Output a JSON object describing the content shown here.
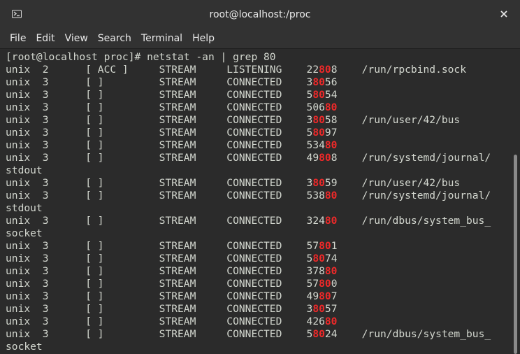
{
  "window": {
    "title": "root@localhost:/proc"
  },
  "menu": [
    "File",
    "Edit",
    "View",
    "Search",
    "Terminal",
    "Help"
  ],
  "terminal": {
    "highlight": "80",
    "highlight_color": "#ef2929",
    "text_color": "#d3d7cf",
    "prompt_line": "[root@localhost proc]# netstat -an | grep 80",
    "rows": [
      {
        "proto": "unix",
        "refcnt": "2",
        "flags": "[ ACC ]",
        "type": "STREAM",
        "state": "LISTENING",
        "inode": "22808",
        "path": "/run/rpcbind.sock"
      },
      {
        "proto": "unix",
        "refcnt": "3",
        "flags": "[ ]",
        "type": "STREAM",
        "state": "CONNECTED",
        "inode": "38056",
        "path": ""
      },
      {
        "proto": "unix",
        "refcnt": "3",
        "flags": "[ ]",
        "type": "STREAM",
        "state": "CONNECTED",
        "inode": "58054",
        "path": ""
      },
      {
        "proto": "unix",
        "refcnt": "3",
        "flags": "[ ]",
        "type": "STREAM",
        "state": "CONNECTED",
        "inode": "50680",
        "path": ""
      },
      {
        "proto": "unix",
        "refcnt": "3",
        "flags": "[ ]",
        "type": "STREAM",
        "state": "CONNECTED",
        "inode": "38058",
        "path": "/run/user/42/bus"
      },
      {
        "proto": "unix",
        "refcnt": "3",
        "flags": "[ ]",
        "type": "STREAM",
        "state": "CONNECTED",
        "inode": "58097",
        "path": ""
      },
      {
        "proto": "unix",
        "refcnt": "3",
        "flags": "[ ]",
        "type": "STREAM",
        "state": "CONNECTED",
        "inode": "53480",
        "path": ""
      },
      {
        "proto": "unix",
        "refcnt": "3",
        "flags": "[ ]",
        "type": "STREAM",
        "state": "CONNECTED",
        "inode": "49808",
        "path": "/run/systemd/journal/",
        "wrap": "stdout"
      },
      {
        "proto": "unix",
        "refcnt": "3",
        "flags": "[ ]",
        "type": "STREAM",
        "state": "CONNECTED",
        "inode": "38059",
        "path": "/run/user/42/bus"
      },
      {
        "proto": "unix",
        "refcnt": "3",
        "flags": "[ ]",
        "type": "STREAM",
        "state": "CONNECTED",
        "inode": "53880",
        "path": "/run/systemd/journal/",
        "wrap": "stdout"
      },
      {
        "proto": "unix",
        "refcnt": "3",
        "flags": "[ ]",
        "type": "STREAM",
        "state": "CONNECTED",
        "inode": "32480",
        "path": "/run/dbus/system_bus_",
        "wrap": "socket"
      },
      {
        "proto": "unix",
        "refcnt": "3",
        "flags": "[ ]",
        "type": "STREAM",
        "state": "CONNECTED",
        "inode": "57801",
        "path": ""
      },
      {
        "proto": "unix",
        "refcnt": "3",
        "flags": "[ ]",
        "type": "STREAM",
        "state": "CONNECTED",
        "inode": "58074",
        "path": ""
      },
      {
        "proto": "unix",
        "refcnt": "3",
        "flags": "[ ]",
        "type": "STREAM",
        "state": "CONNECTED",
        "inode": "37880",
        "path": ""
      },
      {
        "proto": "unix",
        "refcnt": "3",
        "flags": "[ ]",
        "type": "STREAM",
        "state": "CONNECTED",
        "inode": "57800",
        "path": ""
      },
      {
        "proto": "unix",
        "refcnt": "3",
        "flags": "[ ]",
        "type": "STREAM",
        "state": "CONNECTED",
        "inode": "49807",
        "path": ""
      },
      {
        "proto": "unix",
        "refcnt": "3",
        "flags": "[ ]",
        "type": "STREAM",
        "state": "CONNECTED",
        "inode": "38057",
        "path": ""
      },
      {
        "proto": "unix",
        "refcnt": "3",
        "flags": "[ ]",
        "type": "STREAM",
        "state": "CONNECTED",
        "inode": "42680",
        "path": ""
      },
      {
        "proto": "unix",
        "refcnt": "3",
        "flags": "[ ]",
        "type": "STREAM",
        "state": "CONNECTED",
        "inode": "58024",
        "path": "/run/dbus/system_bus_",
        "wrap": "socket"
      }
    ]
  },
  "icons": {
    "app": "terminal-icon",
    "close": "close-icon"
  }
}
